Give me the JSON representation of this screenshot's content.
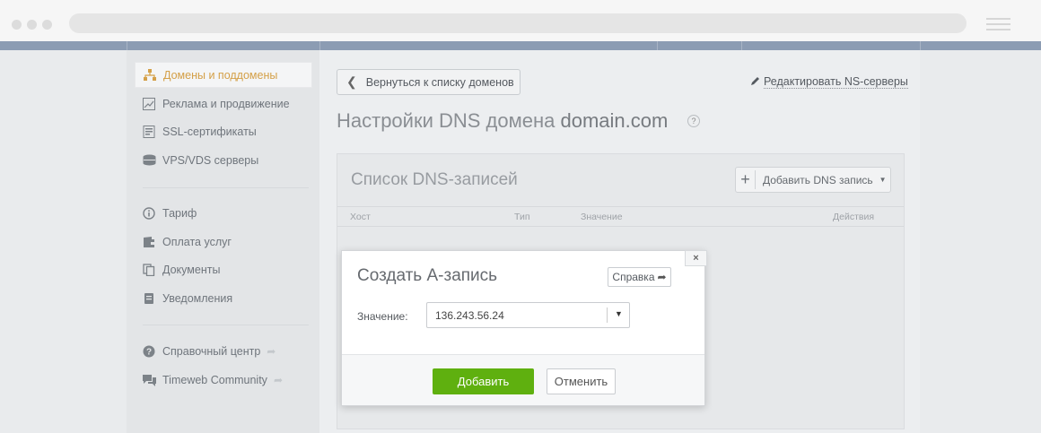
{
  "sidebar": {
    "items": [
      {
        "label": "Домены и поддомены",
        "icon": "sitemap-icon",
        "active": true
      },
      {
        "label": "Реклама и продвижение",
        "icon": "chart-icon"
      },
      {
        "label": "SSL-сертификаты",
        "icon": "certificate-icon"
      },
      {
        "label": "VPS/VDS серверы",
        "icon": "server-icon"
      },
      {
        "label": "Тариф",
        "icon": "info-icon"
      },
      {
        "label": "Оплата услуг",
        "icon": "wallet-icon"
      },
      {
        "label": "Документы",
        "icon": "documents-icon"
      },
      {
        "label": "Уведомления",
        "icon": "notification-icon"
      },
      {
        "label": "Справочный центр",
        "icon": "help-icon"
      },
      {
        "label": "Timeweb Community",
        "icon": "chat-icon"
      }
    ]
  },
  "main": {
    "back_label": "Вернуться к списку доменов",
    "edit_ns_label": "Редактировать NS-серверы",
    "title_prefix": "Настройки DNS домена",
    "title_domain": "domain.com",
    "help_mark": "?",
    "dns_list": {
      "title": "Список DNS-записей",
      "add_label": "Добавить DNS запись",
      "columns": [
        "Хост",
        "Тип",
        "Значение",
        "Действия"
      ]
    }
  },
  "modal": {
    "title": "Создать А-запись",
    "help_label": "Справка",
    "close_symbol": "×",
    "field_label": "Значение:",
    "field_value": "136.243.56.24",
    "submit_label": "Добавить",
    "cancel_label": "Отменить"
  },
  "colors": {
    "accent": "#d4a048",
    "primary_button": "#5fb00f",
    "topbar": "#8c9cb3"
  }
}
